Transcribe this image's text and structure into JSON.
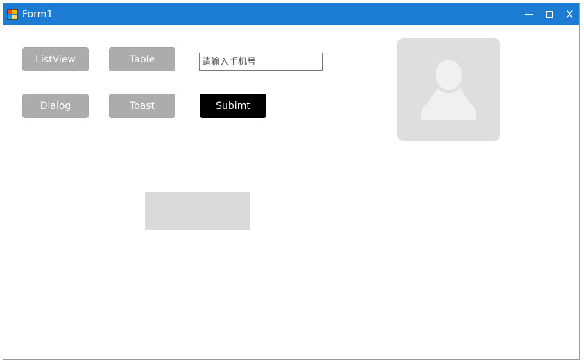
{
  "window": {
    "title": "Form1",
    "close_label": "X"
  },
  "buttons": {
    "listview": "ListView",
    "table": "Table",
    "dialog": "Dialog",
    "toast": "Toast",
    "submit": "Subimt"
  },
  "phone_input": {
    "placeholder": "请输入手机号",
    "value": ""
  },
  "icons": {
    "app": "app-icon",
    "minimize": "minimize-icon",
    "maximize": "maximize-icon",
    "close": "close-icon",
    "avatar": "user-silhouette-icon"
  },
  "colors": {
    "titlebar": "#1c7bd3",
    "button_gray": "#acacac",
    "button_black": "#000000",
    "avatar_bg": "#dedede",
    "panel_bg": "#dadada"
  }
}
